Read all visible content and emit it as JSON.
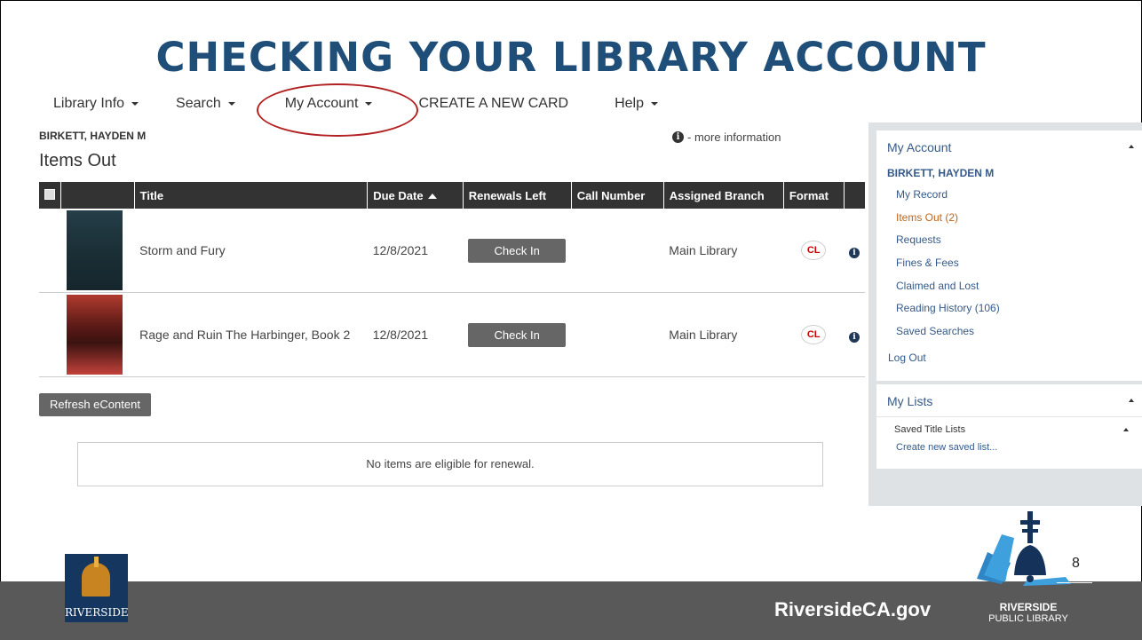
{
  "slide": {
    "title": "CHECKING YOUR LIBRARY ACCOUNT",
    "page_number": "8",
    "website": "RiversideCA.gov",
    "city_logo_text": "RIVERSIDE",
    "library_logo": {
      "name": "RIVERSIDE",
      "subname": "PUBLIC LIBRARY"
    }
  },
  "nav": {
    "library_info": "Library Info",
    "search": "Search",
    "my_account": "My Account",
    "create_card": "CREATE A NEW CARD",
    "help": "Help"
  },
  "account": {
    "patron_name": "BIRKETT, HAYDEN M",
    "more_info": "- more information",
    "section_title": "Items Out",
    "columns": [
      "Title",
      "Due Date",
      "Renewals Left",
      "Call Number",
      "Assigned Branch",
      "Format"
    ],
    "items": [
      {
        "title": "Storm and Fury",
        "due_date": "12/8/2021",
        "action": "Check In",
        "call_number": "",
        "branch": "Main Library",
        "format": "CL"
      },
      {
        "title": "Rage and Ruin The Harbinger, Book 2",
        "due_date": "12/8/2021",
        "action": "Check In",
        "call_number": "",
        "branch": "Main Library",
        "format": "CL"
      }
    ],
    "refresh_label": "Refresh eContent",
    "renewal_message": "No items are eligible for renewal."
  },
  "sidebar": {
    "my_account_title": "My Account",
    "patron_name": "BIRKETT, HAYDEN M",
    "links": [
      {
        "label": "My Record",
        "active": false
      },
      {
        "label": "Items Out (2)",
        "active": true
      },
      {
        "label": "Requests",
        "active": false
      },
      {
        "label": "Fines & Fees",
        "active": false
      },
      {
        "label": "Claimed and Lost",
        "active": false
      },
      {
        "label": "Reading History (106)",
        "active": false
      },
      {
        "label": "Saved Searches",
        "active": false
      }
    ],
    "logout": "Log Out",
    "my_lists_title": "My Lists",
    "saved_title_lists": "Saved Title Lists",
    "create_list": "Create new saved list..."
  },
  "colors": {
    "title": "#1f4e79",
    "highlight_circle": "#b22222",
    "active_link": "#c0651a",
    "link": "#355a8a"
  }
}
